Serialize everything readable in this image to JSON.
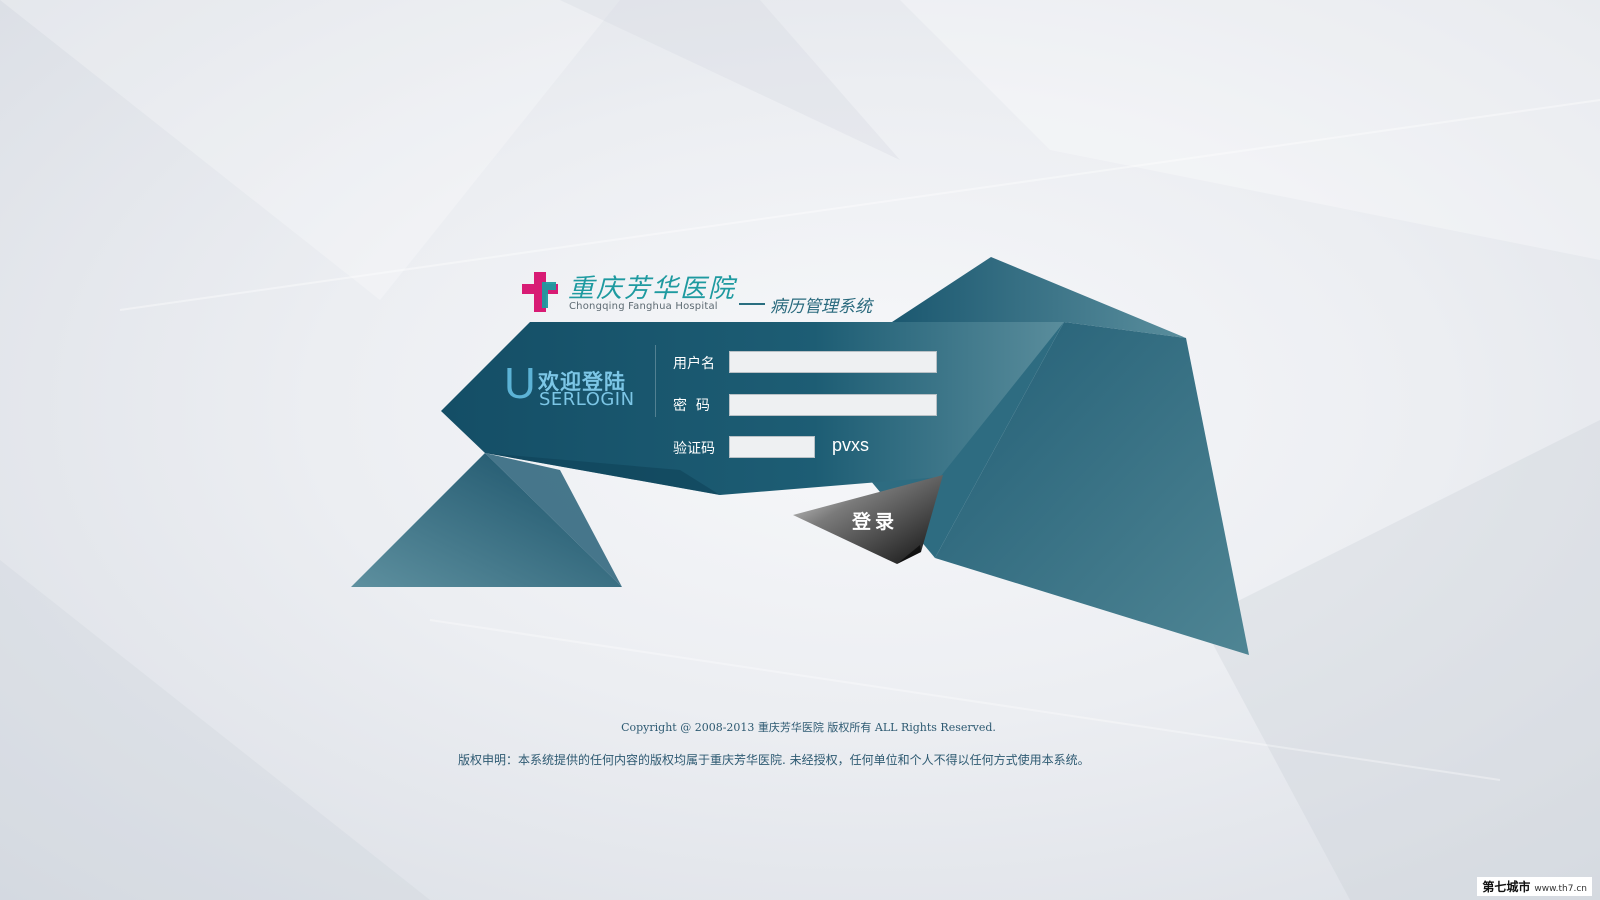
{
  "header": {
    "hospital_name_cn": "重庆芳华医院",
    "hospital_name_en": "Chongqing Fanghua Hospital",
    "system_name": "病历管理系统"
  },
  "welcome": {
    "letter": "U",
    "title_cn": "欢迎登陆",
    "title_en": "SERLOGIN"
  },
  "form": {
    "username_label": "用户名",
    "username_value": "",
    "password_label": "密  码",
    "password_value": "",
    "captcha_label": "验证码",
    "captcha_value": "",
    "captcha_code": "pvxs",
    "login_label": "登录"
  },
  "footer": {
    "copyright": "Copyright @ 2008-2013 重庆芳华医院 版权所有 ALL Rights Reserved.",
    "disclaimer": "版权申明：本系统提供的任何内容的版权均属于重庆芳华医院. 未经授权，任何单位和个人不得以任何方式使用本系统。"
  },
  "watermark": {
    "text": "第七城市",
    "url": "www.th7.cn"
  },
  "colors": {
    "teal_dark": "#154f66",
    "teal_mid": "#2b6a80",
    "teal_light": "#5a8d9e",
    "logo_magenta": "#d81b74",
    "logo_teal": "#1e9aa0"
  }
}
